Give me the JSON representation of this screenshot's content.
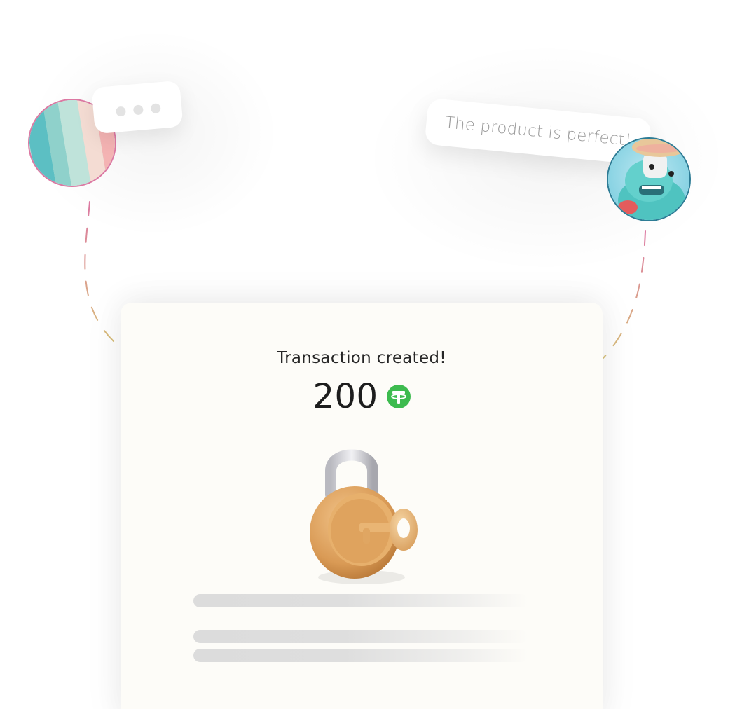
{
  "quote_bubble": {
    "text": "The product is perfect!"
  },
  "typing_bubble": {
    "dots": 3
  },
  "transaction_card": {
    "title": "Transaction created!",
    "amount": "200",
    "currency_icon": "tether-usdt-icon"
  },
  "colors": {
    "left_avatar_border": "#dc78a2",
    "right_avatar_border": "#2d7c95",
    "tether_green": "#3dbb4f",
    "dash_pink": "#dc78a2",
    "dash_yellow": "#d9c37a",
    "card_background": "#fdfcf8"
  },
  "icons": {
    "lock": "padlock-with-key-icon",
    "left_avatar": "avatar-abstract-stripes",
    "right_avatar": "avatar-3d-character"
  }
}
